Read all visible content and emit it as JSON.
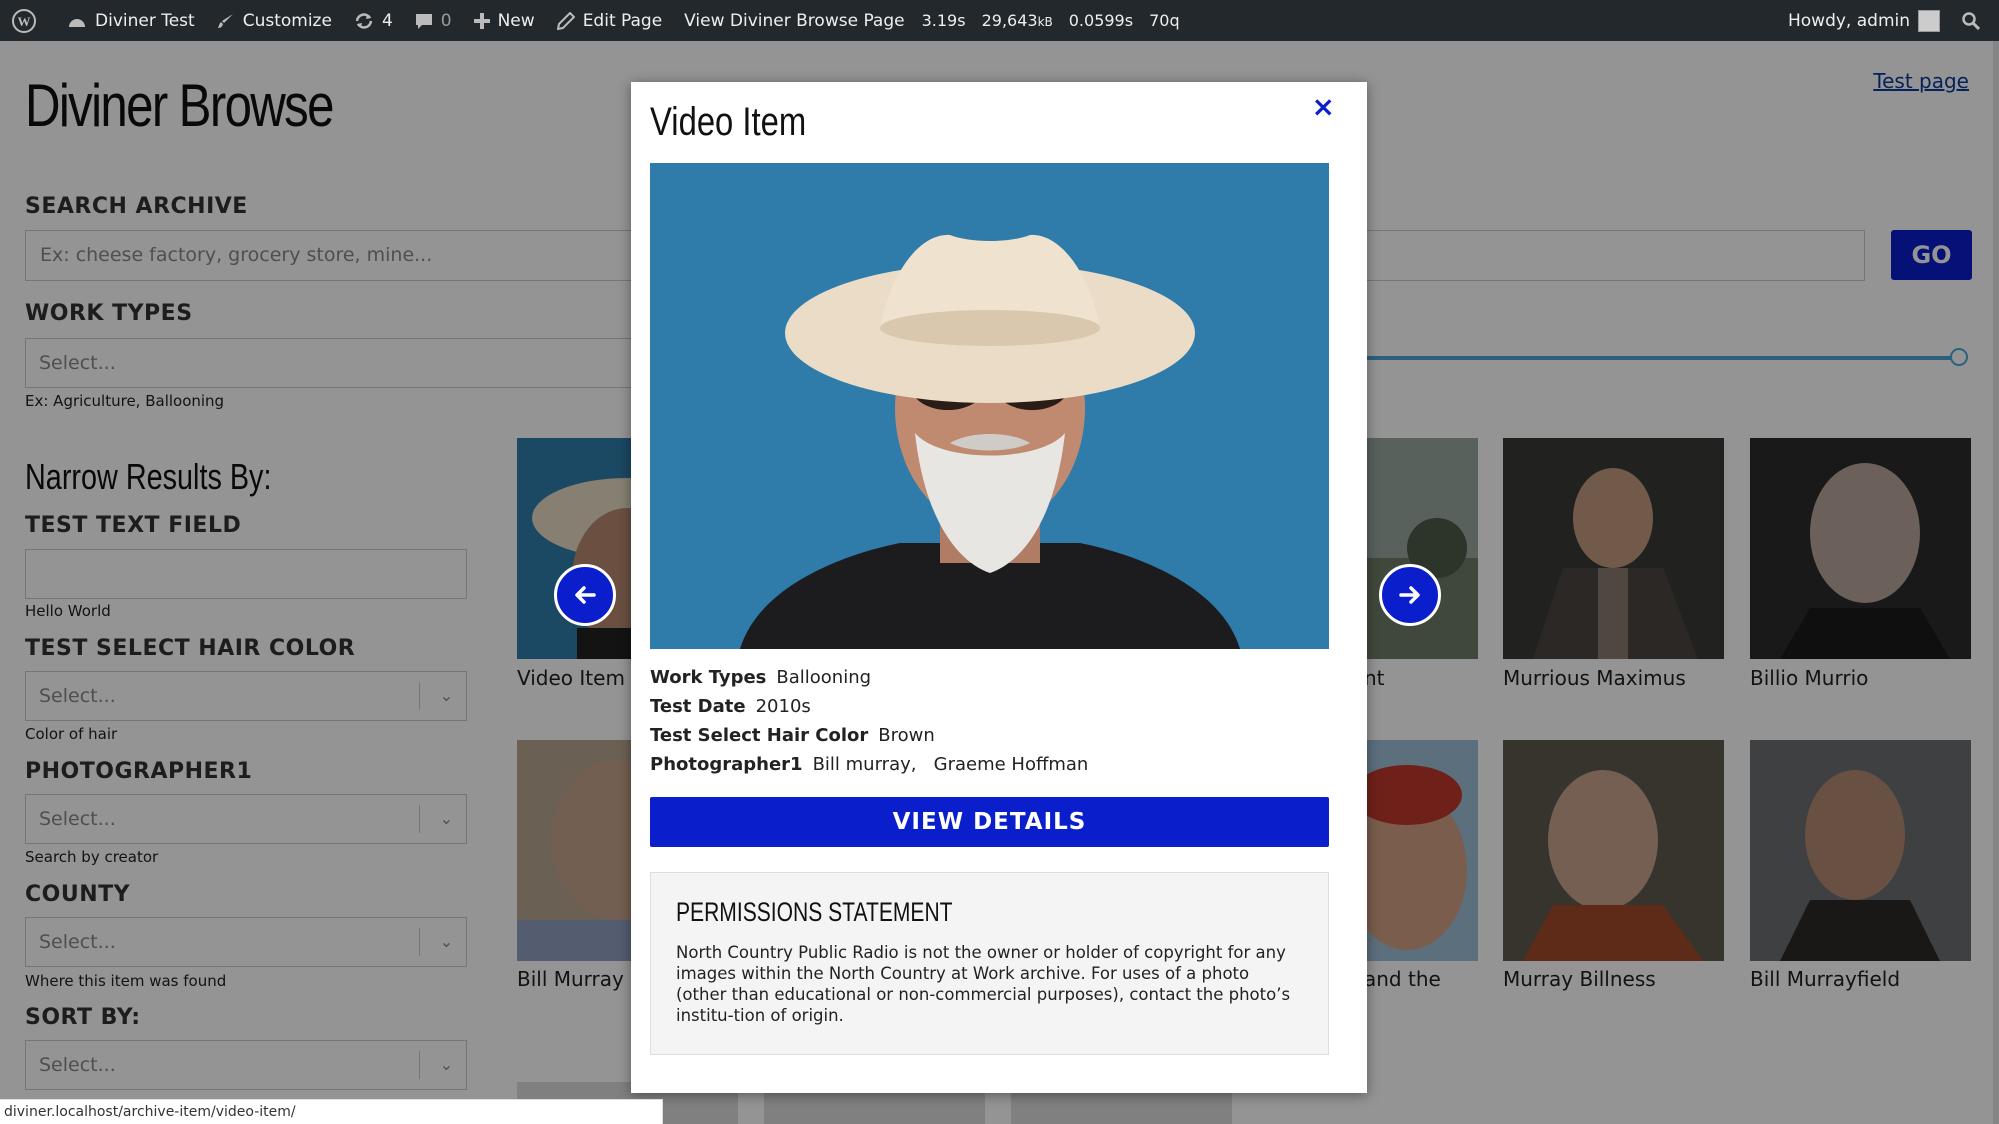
{
  "adminbar": {
    "site_name": "Diviner Test",
    "customize": "Customize",
    "updates_count": "4",
    "comments_count": "0",
    "new_label": "New",
    "edit_page": "Edit Page",
    "view_page": "View Diviner Browse Page",
    "stat_time": "3.19s",
    "stat_mem_value": "29,643",
    "stat_mem_unit": "kB",
    "stat_db_time": "0.0599s",
    "stat_queries": "70q",
    "howdy": "Howdy, admin"
  },
  "page": {
    "title": "Diviner Browse",
    "test_page_link": "Test page",
    "search_label": "SEARCH ARCHIVE",
    "search_placeholder": "Ex: cheese factory, grocery store, mine...",
    "go_label": "GO",
    "work_types_label": "WORK TYPES",
    "work_types_placeholder": "Select...",
    "work_types_help": "Ex: Agriculture, Ballooning",
    "narrow_heading": "Narrow Results By:",
    "filters": [
      {
        "label": "TEST TEXT FIELD",
        "help": "Hello World"
      },
      {
        "label": "TEST SELECT HAIR COLOR",
        "placeholder": "Select...",
        "help": "Color of hair"
      },
      {
        "label": "PHOTOGRAPHER1",
        "placeholder": "Select...",
        "help": "Search by creator"
      },
      {
        "label": "COUNTY",
        "placeholder": "Select...",
        "help": "Where this item was found"
      },
      {
        "label": "SORT BY:",
        "placeholder": "Select..."
      }
    ],
    "cards": [
      {
        "caption": "Video Item"
      },
      {
        "caption": "nt"
      },
      {
        "caption": "Murrious Maximus"
      },
      {
        "caption": "Billio Murrio"
      },
      {
        "caption": "Bill Murray I"
      },
      {
        "caption": "and the"
      },
      {
        "caption": "Murray Billness"
      },
      {
        "caption": "Bill Murrayfield"
      }
    ]
  },
  "modal": {
    "title": "Video Item",
    "close": "×",
    "meta": [
      {
        "key": "Work Types",
        "value": "Ballooning"
      },
      {
        "key": "Test Date",
        "value": "2010s"
      },
      {
        "key": "Test Select Hair Color",
        "value": "Brown"
      },
      {
        "key": "Photographer1",
        "value": "Bill murray,   Graeme Hoffman"
      }
    ],
    "view_details": "VIEW DETAILS",
    "permissions_title": "PERMISSIONS STATEMENT",
    "permissions_text": "North Country Public Radio is not the owner or holder of copyright for any images within the North Country at Work archive. For uses of a photo (other than educational or non-commercial purposes), contact the photo’s institu-tion of origin.",
    "prev_icon": "arrow-left-icon",
    "next_icon": "arrow-right-icon"
  },
  "statusbar": {
    "url": "diviner.localhost/archive-item/video-item/"
  }
}
